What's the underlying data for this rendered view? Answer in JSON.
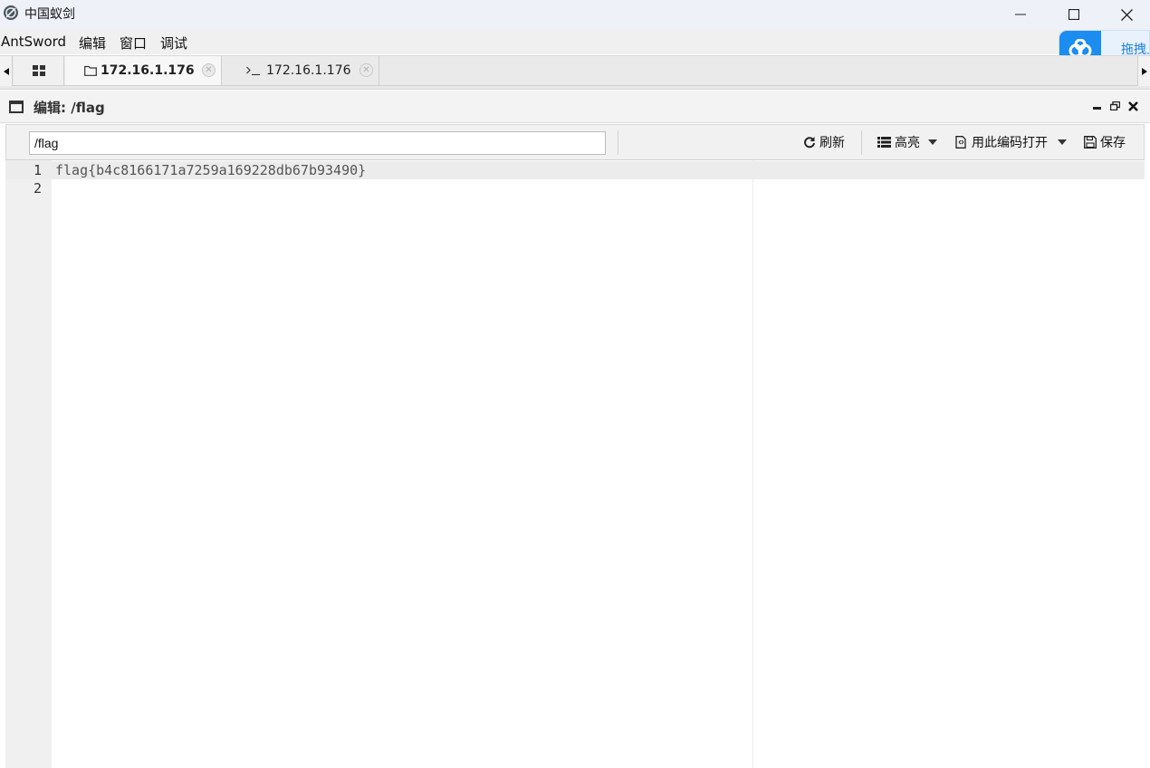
{
  "window": {
    "title": "中国蚁剑",
    "controls": {
      "minimize_icon": "minimize-icon",
      "maximize_icon": "maximize-icon",
      "close_icon": "close-icon"
    }
  },
  "menu": {
    "items": [
      "AntSword",
      "编辑",
      "窗口",
      "调试"
    ]
  },
  "baidu_widget": {
    "text": "拖拽上传"
  },
  "tabs": {
    "grid_icon": "grid-icon",
    "items": [
      {
        "icon": "folder-icon",
        "label": "172.16.1.176",
        "active": true
      },
      {
        "icon": "terminal-icon",
        "label": "172.16.1.176",
        "active": false
      }
    ]
  },
  "panel": {
    "title": "编辑: /flag",
    "path_value": "/flag",
    "toolbar": {
      "refresh_label": "刷新",
      "highlight_label": "高亮",
      "encode_label": "用此编码打开",
      "save_label": "保存"
    }
  },
  "editor": {
    "lines": [
      {
        "number": "1",
        "text": "flag{b4c8166171a7259a169228db67b93490}"
      },
      {
        "number": "2",
        "text": ""
      }
    ],
    "active_line": 1
  }
}
